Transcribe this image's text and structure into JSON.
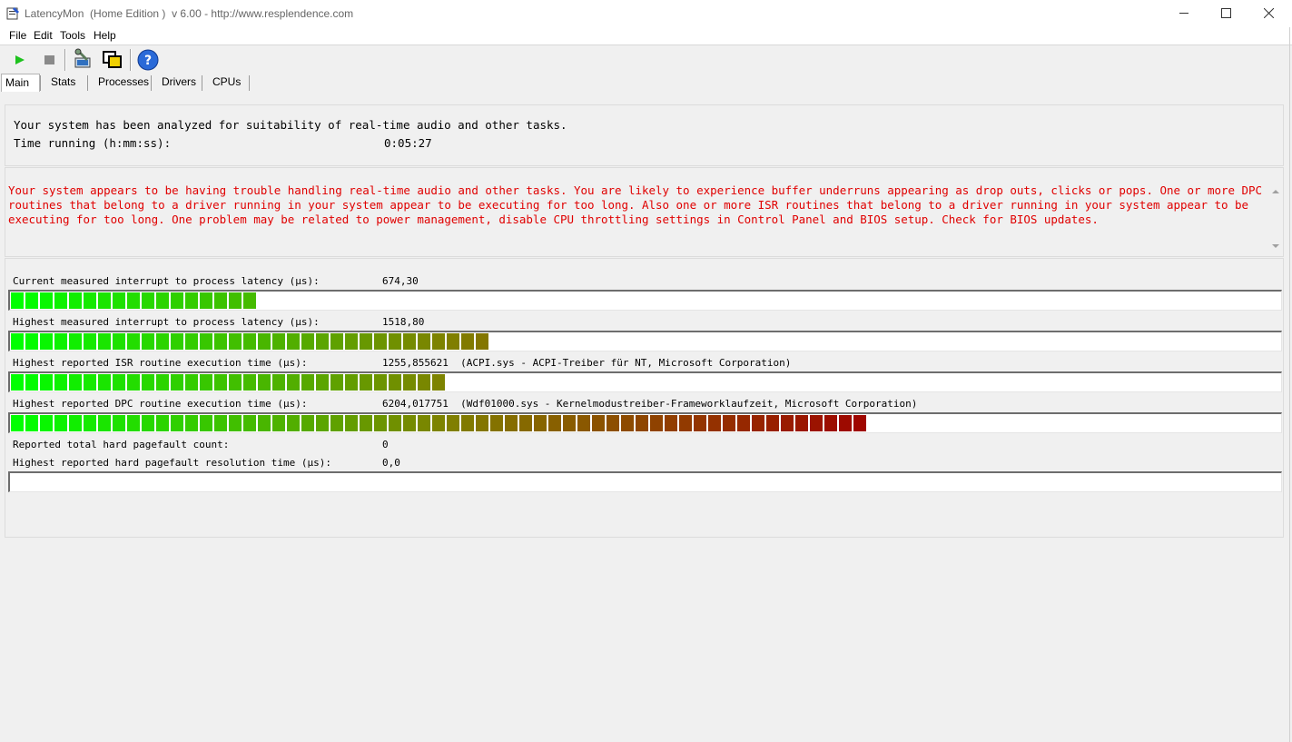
{
  "window": {
    "title": "LatencyMon  (Home Edition )  v 6.00 - http://www.resplendence.com",
    "icon": "app-icon",
    "controls": [
      "minimize-icon",
      "maximize-icon",
      "close-icon"
    ]
  },
  "menu": {
    "file": "File",
    "edit": "Edit",
    "tools": "Tools",
    "help": "Help"
  },
  "toolbar": {
    "buttons": [
      "play-icon",
      "stop-icon",
      "computer-wrench-icon",
      "windows-icon",
      "help-icon"
    ]
  },
  "tabs": {
    "main": "Main",
    "stats": "Stats",
    "processes": "Processes",
    "drivers": "Drivers",
    "cpus": "CPUs",
    "active": "Main"
  },
  "summary": {
    "line1": "Your system has been analyzed for suitability of real-time audio and other tasks.",
    "time_label": "Time running (h:mm:ss):",
    "time_value": "0:05:27"
  },
  "warning": {
    "text": "Your system appears to be having trouble handling real-time audio and other tasks. You are likely to experience buffer underruns appearing as drop outs, clicks or pops. One or more DPC routines that belong to a driver running in your system appear to be executing for too long. Also one or more ISR routines that belong to a driver running in your system appear to be executing for too long. One problem may be related to power management, disable CPU throttling settings in Control Panel and BIOS setup. Check for BIOS updates.",
    "color": "#e00000"
  },
  "metrics": {
    "current_latency": {
      "label": "Current measured interrupt to process latency (µs):",
      "value": "674,30",
      "bar_fraction": 0.194
    },
    "highest_latency": {
      "label": "Highest measured interrupt to process latency (µs):",
      "value": "1518,80",
      "bar_fraction": 0.376
    },
    "highest_isr": {
      "label": "Highest reported ISR routine execution time (µs):",
      "value": "1255,855621  (ACPI.sys - ACPI-Treiber für NT, Microsoft Corporation)",
      "bar_fraction": 0.342
    },
    "highest_dpc": {
      "label": "Highest reported DPC routine execution time (µs):",
      "value": "6204,017751  (Wdf01000.sys - Kernelmodustreiber-Frameworklaufzeit, Microsoft Corporation)",
      "bar_fraction": 0.674
    },
    "pagefault_count": {
      "label": "Reported total hard pagefault count:",
      "value": "0"
    },
    "pagefault_time": {
      "label": "Highest reported hard pagefault resolution time (µs):",
      "value": "0,0",
      "bar_fraction": 0
    }
  },
  "colors": {
    "bar_start": "#00ff00",
    "bar_mid": "#808000",
    "bar_end": "#a00000"
  }
}
